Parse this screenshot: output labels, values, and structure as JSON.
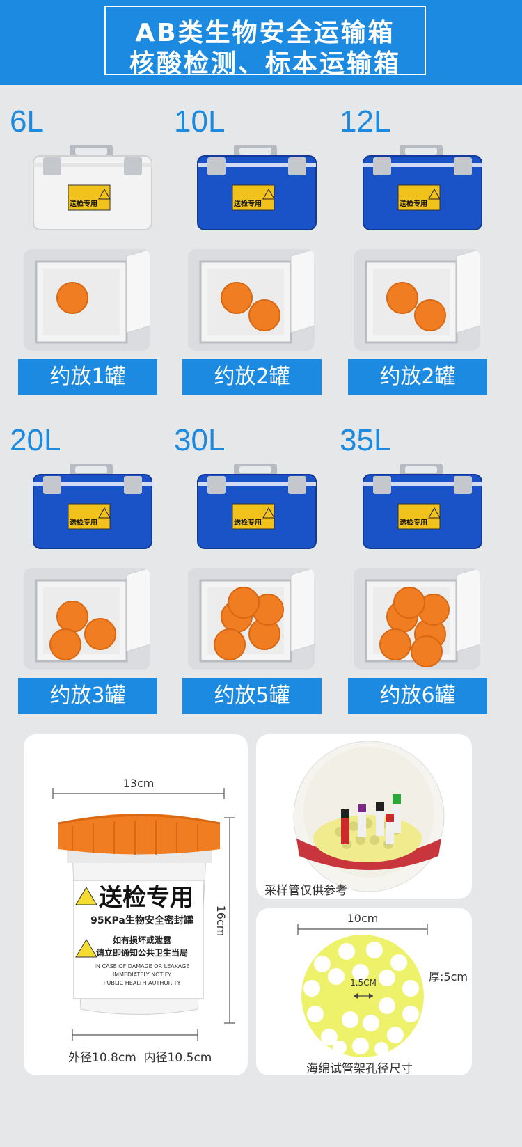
{
  "banner": {
    "line1": "AB类生物安全运输箱",
    "line2": "核酸检测、标本运输箱"
  },
  "colors": {
    "accent": "#1b8ae0",
    "box_blue": "#1a52c8",
    "lid_orange": "#f07d22",
    "sponge_yellow": "#eef26a"
  },
  "products": [
    {
      "capacity": "6L",
      "caption": "约放1罐",
      "box_color": "white"
    },
    {
      "capacity": "10L",
      "caption": "约放2罐",
      "box_color": "blue"
    },
    {
      "capacity": "12L",
      "caption": "约放2罐",
      "box_color": "blue"
    },
    {
      "capacity": "20L",
      "caption": "约放3罐",
      "box_color": "blue"
    },
    {
      "capacity": "30L",
      "caption": "约放5罐",
      "box_color": "blue"
    },
    {
      "capacity": "35L",
      "caption": "约放6罐",
      "box_color": "blue"
    }
  ],
  "box_sticker": "送检专用",
  "can_panel": {
    "width_label": "13cm",
    "height_label": "16cm",
    "label_title": "送检专用",
    "label_sub": "95KPa生物安全密封罐",
    "label_warn1": "如有损坏或泄露",
    "label_warn2": "请立即通知公共卫生当局",
    "label_en1": "IN CASE OF DAMAGE OR LEAKAGE",
    "label_en2": "IMMEDIATELY NOTIFY",
    "label_en3": "PUBLIC HEALTH AUTHORITY",
    "diameter_text": "外径10.8cm  内径10.5cm"
  },
  "tube_panel": {
    "caption": "采样管仅供参考"
  },
  "sponge_panel": {
    "width_label": "10cm",
    "hole_label": "1.5CM",
    "thickness_label": "厚:5cm",
    "caption": "海绵试管架孔径尺寸"
  }
}
